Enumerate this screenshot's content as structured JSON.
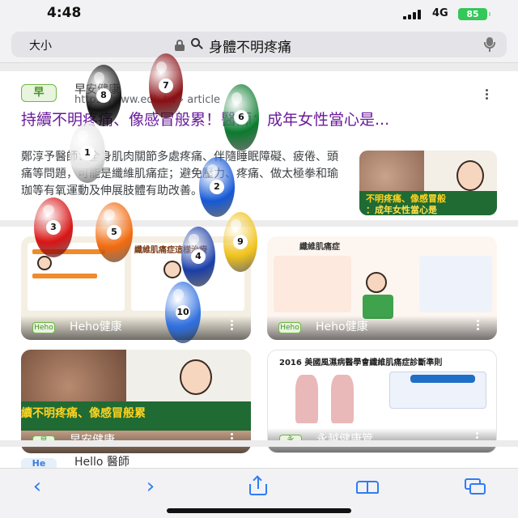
{
  "status": {
    "time": "4:48",
    "network": "4G",
    "battery": "85"
  },
  "address_bar": {
    "text_size_label": "大小",
    "query": "身體不明疼痛"
  },
  "result": {
    "site_icon_text": "早",
    "site_name": "早安健康",
    "site_url": "https://www.edh.tw › article",
    "title": "持續不明疼痛、像感冒般累！醫師：成年女性當心是...",
    "snippet": "鄭淳予醫師：全身肌肉關節多處疼痛、伴隨睡眠障礙、疲倦、頭痛等問題，可能是纖維肌痛症；避免壓力、疼痛、做太極拳和瑜珈等有氧運動及伸展肢體有助改善。",
    "thumb_caption_line1": "不明疼痛、像感冒般",
    "thumb_caption_line2": "：成年女性當心是"
  },
  "image_tiles": [
    {
      "label": "Heho健康",
      "logo": "Heho",
      "caption": "纖維肌痛症這樣治療"
    },
    {
      "label": "Heho健康",
      "logo": "Heho",
      "caption": "纖維肌痛症"
    },
    {
      "label": "早安健康",
      "logo": "早",
      "caption": "續不明疼痛、像感冒般累"
    },
    {
      "label": "永越健康管…",
      "logo": "永",
      "caption": "2016 美國風濕病醫學會纖維肌痛症診斷準則"
    }
  ],
  "next_result": {
    "icon_text": "He",
    "site_name": "Hello 醫師"
  },
  "overlay_balls": [
    {
      "number": "8",
      "color": "#111111"
    },
    {
      "number": "7",
      "color": "#8b0f14"
    },
    {
      "number": "6",
      "color": "#0b7a2e"
    },
    {
      "number": "1",
      "color": "#e5e5e5"
    },
    {
      "number": "2",
      "color": "#1558d6"
    },
    {
      "number": "3",
      "color": "#d81515"
    },
    {
      "number": "5",
      "color": "#f26b0f"
    },
    {
      "number": "4",
      "color": "#1a3ea8"
    },
    {
      "number": "9",
      "color": "#f0c21b"
    },
    {
      "number": "10",
      "color": "#2e6fe0"
    }
  ],
  "colors": {
    "accent": "#2f7cf6",
    "visited_link": "#6a1b9a",
    "battery": "#34c759"
  }
}
